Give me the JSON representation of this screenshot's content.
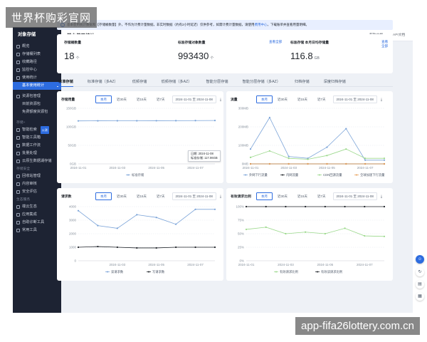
{
  "watermarks": {
    "top": "世界杯购彩官网",
    "bottom": "app-fifa26lottery.com.cn"
  },
  "sidebar": {
    "title": "对象存储",
    "items": [
      {
        "label": "概览",
        "type": "item"
      },
      {
        "label": "存储桶列表",
        "type": "item"
      },
      {
        "label": "收藏路径",
        "type": "item"
      },
      {
        "label": "监控中心",
        "type": "item"
      },
      {
        "label": "使用统计",
        "type": "item"
      },
      {
        "label": "基本使用统计",
        "type": "sub",
        "active": true
      },
      {
        "type": "gap"
      },
      {
        "label": "资源包管理",
        "type": "item"
      },
      {
        "label": "目前资源包",
        "type": "sub"
      },
      {
        "label": "免费额度资源包",
        "type": "sub"
      },
      {
        "type": "gap"
      },
      {
        "label": "存储+",
        "type": "section"
      },
      {
        "label": "智能检索",
        "type": "item",
        "tag": "公测"
      },
      {
        "label": "智能工具箱",
        "type": "item"
      },
      {
        "label": "数据工作流",
        "type": "item"
      },
      {
        "label": "批量处理",
        "type": "item"
      },
      {
        "label": "云原生数据湖存储",
        "type": "item"
      },
      {
        "label": "存储安全",
        "type": "section"
      },
      {
        "label": "回收站管理",
        "type": "item"
      },
      {
        "label": "内容审核",
        "type": "item"
      },
      {
        "label": "安全评估",
        "type": "item"
      },
      {
        "label": "生态服务",
        "type": "section"
      },
      {
        "label": "端云生态",
        "type": "item"
      },
      {
        "label": "应用集成",
        "type": "item"
      },
      {
        "label": "自助诊断工具",
        "type": "item"
      },
      {
        "label": "常用工具",
        "type": "item"
      }
    ]
  },
  "header": {
    "title": "基本使用统计",
    "help": "帮助文档",
    "api": "API文档"
  },
  "notice": {
    "text": "基本使用统计数据和【存储桶数量】外，不作为计费计量数据，非实时数据（约有2小时延迟）仅供参考，如需计费计量数据，请使用",
    "link": "费用中心",
    "tail": "，下载账单并查看用量明细。"
  },
  "summary": [
    {
      "label": "存储桶数量",
      "value": "18",
      "unit": "个",
      "link": ""
    },
    {
      "label": "标准存储对象数量",
      "value": "993430",
      "unit": "个",
      "link": "查看全部"
    },
    {
      "label": "标准存储 本月日均存储量",
      "value": "116.8",
      "unit": "GB",
      "link": "查看全部"
    }
  ],
  "tabs": [
    {
      "label": "标准存储",
      "active": true
    },
    {
      "label": "标准存储（多AZ）"
    },
    {
      "label": "低频存储"
    },
    {
      "label": "低频存储（多AZ）"
    },
    {
      "label": "智能分层存储"
    },
    {
      "label": "智能分层存储（多AZ）"
    },
    {
      "label": "归档存储"
    },
    {
      "label": "深度归档存储"
    }
  ],
  "controls": {
    "pills": [
      "本月",
      "近30天",
      "近15天",
      "近7天"
    ],
    "date": "2024-11-01 至 2024-11-08",
    "download": "⤓"
  },
  "tooltip": {
    "date": "日期: 2024-11-08",
    "value": "标准存储: 117.06GB"
  },
  "charts": [
    {
      "title": "存储用量",
      "x": [
        "2024-11-01",
        "2024-11-03",
        "2024-11-05",
        "2024-11-07"
      ],
      "yticks": [
        "150GB",
        "100GB",
        "50GB",
        "0GB"
      ]
    },
    {
      "title": "流量",
      "x": [
        "2024-11-01",
        "2024-11-03",
        "2024-11-05",
        "2024-11-07"
      ],
      "yticks": [
        "300MB",
        "200MB",
        "100MB",
        "0MB"
      ]
    },
    {
      "title": "请求数",
      "x": [
        "2024-11-03",
        "2024-11-05",
        "2024-11-07"
      ],
      "yticks": [
        "4000",
        "3000",
        "2000",
        "1000",
        "0"
      ]
    },
    {
      "title": "有效请求比例",
      "x": [
        "2024-11-01",
        "2024-11-03",
        "2024-11-05",
        "2024-11-07"
      ],
      "yticks": [
        "100%",
        "75%",
        "50%",
        "25%",
        "0%"
      ]
    }
  ],
  "chart_data": [
    {
      "type": "line",
      "title": "存储用量",
      "x": [
        "2024-11-01",
        "2024-11-02",
        "2024-11-03",
        "2024-11-04",
        "2024-11-05",
        "2024-11-06",
        "2024-11-07",
        "2024-11-08"
      ],
      "ylim": [
        0,
        150
      ],
      "series": [
        {
          "name": "标准存储",
          "color": "#7aa3d8",
          "values": [
            116,
            116.2,
            116.3,
            116.4,
            116.5,
            116.6,
            116.8,
            117.06
          ]
        }
      ]
    },
    {
      "type": "line",
      "title": "流量",
      "x": [
        "2024-11-01",
        "2024-11-02",
        "2024-11-03",
        "2024-11-04",
        "2024-11-05",
        "2024-11-06",
        "2024-11-07",
        "2024-11-08"
      ],
      "ylim": [
        0,
        300
      ],
      "series": [
        {
          "name": "外网下行流量",
          "color": "#7aa3d8",
          "values": [
            80,
            250,
            40,
            30,
            90,
            190,
            20,
            20
          ]
        },
        {
          "name": "内网流量",
          "color": "#1f2329",
          "values": [
            0,
            0,
            0,
            0,
            0,
            0,
            0,
            0
          ]
        },
        {
          "name": "CDN回源流量",
          "color": "#9ad88a",
          "values": [
            35,
            70,
            30,
            25,
            45,
            80,
            30,
            30
          ]
        },
        {
          "name": "全球加速下行流量",
          "color": "#e8a05a",
          "values": [
            0,
            0,
            0,
            0,
            0,
            0,
            0,
            0
          ]
        }
      ]
    },
    {
      "type": "line",
      "title": "请求数",
      "x": [
        "2024-11-01",
        "2024-11-02",
        "2024-11-03",
        "2024-11-04",
        "2024-11-05",
        "2024-11-06",
        "2024-11-07",
        "2024-11-08"
      ],
      "ylim": [
        0,
        4000
      ],
      "series": [
        {
          "name": "读请求数",
          "color": "#7aa3d8",
          "values": [
            3700,
            2600,
            2400,
            3400,
            3200,
            2700,
            3800,
            3800
          ]
        },
        {
          "name": "写请求数",
          "color": "#1f2329",
          "values": [
            1000,
            1050,
            1000,
            950,
            950,
            1000,
            1000,
            1000
          ]
        }
      ]
    },
    {
      "type": "line",
      "title": "有效请求比例",
      "x": [
        "2024-11-01",
        "2024-11-02",
        "2024-11-03",
        "2024-11-04",
        "2024-11-05",
        "2024-11-06",
        "2024-11-07",
        "2024-11-08"
      ],
      "ylim": [
        0,
        100
      ],
      "series": [
        {
          "name": "有效请求比例",
          "color": "#9ad88a",
          "values": [
            58,
            62,
            50,
            53,
            50,
            60,
            46,
            45
          ]
        },
        {
          "name": "有效读请求比例",
          "color": "#1f2329",
          "values": [
            100,
            100,
            100,
            100,
            100,
            100,
            100,
            100
          ]
        }
      ]
    }
  ]
}
